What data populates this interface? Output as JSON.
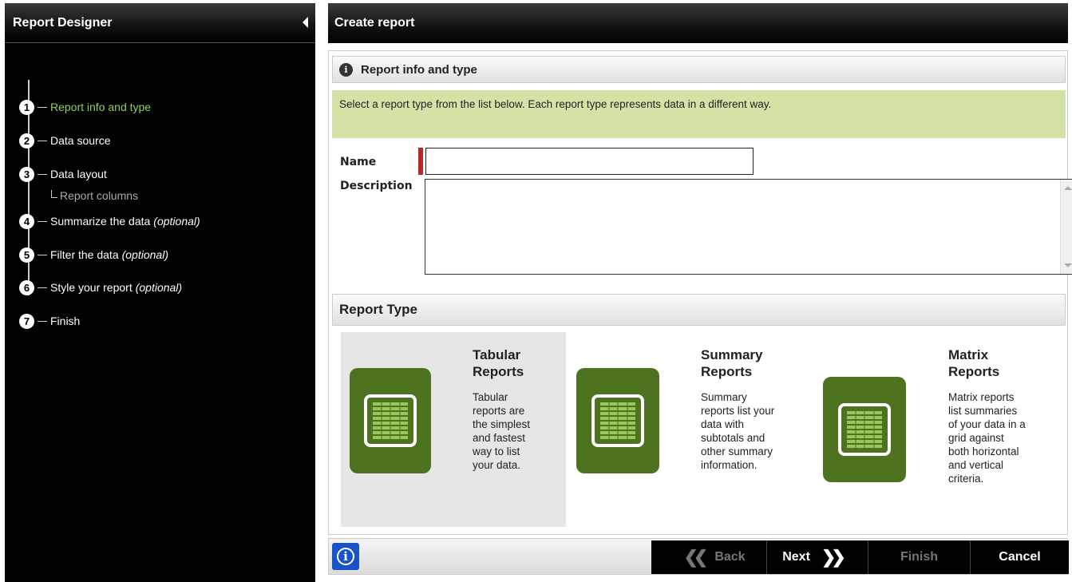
{
  "sidebar": {
    "title": "Report Designer",
    "steps": [
      {
        "num": "1",
        "label": "Report info and type",
        "optional": ""
      },
      {
        "num": "2",
        "label": "Data source",
        "optional": ""
      },
      {
        "num": "3",
        "label": "Data layout",
        "optional": ""
      },
      {
        "num": "4",
        "label": "Summarize the data",
        "optional": "(optional)"
      },
      {
        "num": "5",
        "label": "Filter the data",
        "optional": "(optional)"
      },
      {
        "num": "6",
        "label": "Style your report",
        "optional": "(optional)"
      },
      {
        "num": "7",
        "label": "Finish",
        "optional": ""
      }
    ],
    "substep": "Report columns",
    "active_color": "#8fd15a"
  },
  "main": {
    "title": "Create report",
    "section_title": "Report info and type",
    "instructions": "Select a report type from the list below. Each report type represents data in a different way.",
    "name_label": "Name",
    "name_value": "",
    "description_label": "Description",
    "description_value": "",
    "report_type_title": "Report Type",
    "report_types": [
      {
        "title_line1": "Tabular",
        "title_line2": "Reports",
        "desc": [
          "Tabular",
          "reports are",
          "the simplest",
          "and fastest",
          "way to list",
          "your data."
        ],
        "selected": true
      },
      {
        "title_line1": "Summary",
        "title_line2": "Reports",
        "desc": [
          "Summary",
          "reports list your",
          "data with",
          "subtotals and",
          "other summary",
          "information."
        ],
        "selected": false
      },
      {
        "title_line1": "Matrix",
        "title_line2": "Reports",
        "desc": [
          "Matrix reports",
          "list summaries",
          "of your data in a",
          "grid against",
          "both horizontal",
          "and vertical",
          "criteria."
        ],
        "selected": false
      }
    ],
    "tile_color": "#4e7320"
  },
  "footer": {
    "back_label": "Back",
    "next_label": "Next",
    "finish_label": "Finish",
    "cancel_label": "Cancel",
    "help_color": "#1a52c7"
  }
}
